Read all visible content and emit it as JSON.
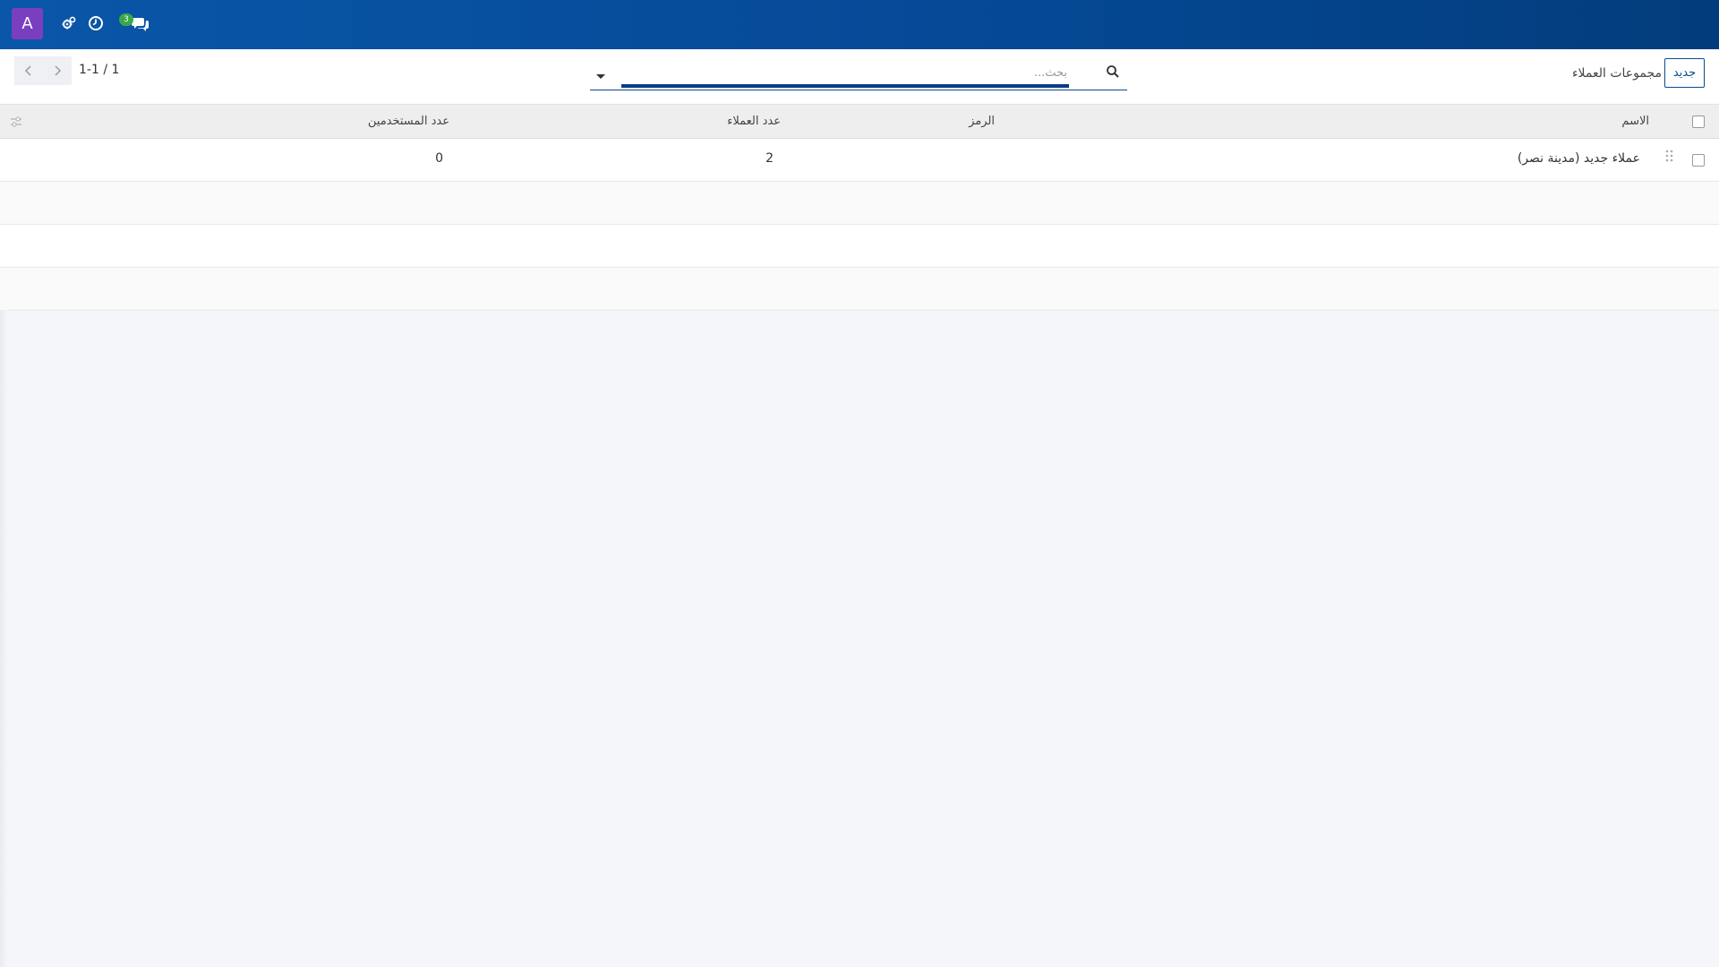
{
  "navbar": {
    "avatar_letter": "A",
    "messages_badge": "3",
    "icons": [
      "settings-icon",
      "clock-icon",
      "chat-icon"
    ],
    "color": "#0a56a8"
  },
  "control_panel": {
    "new_button_label": "جديد",
    "title": "مجموعات العملاء",
    "search_placeholder": "بحث...",
    "pager_value": "1-1 / 1"
  },
  "table": {
    "columns": {
      "name": "الاسم",
      "code": "الرمز",
      "customers_count": "عدد العملاء",
      "users_count": "عدد المستخدمين"
    },
    "rows": [
      {
        "name": "عملاء جديد (مدينة نصر)",
        "code": "",
        "customers_count": "2",
        "users_count": "0"
      }
    ]
  }
}
